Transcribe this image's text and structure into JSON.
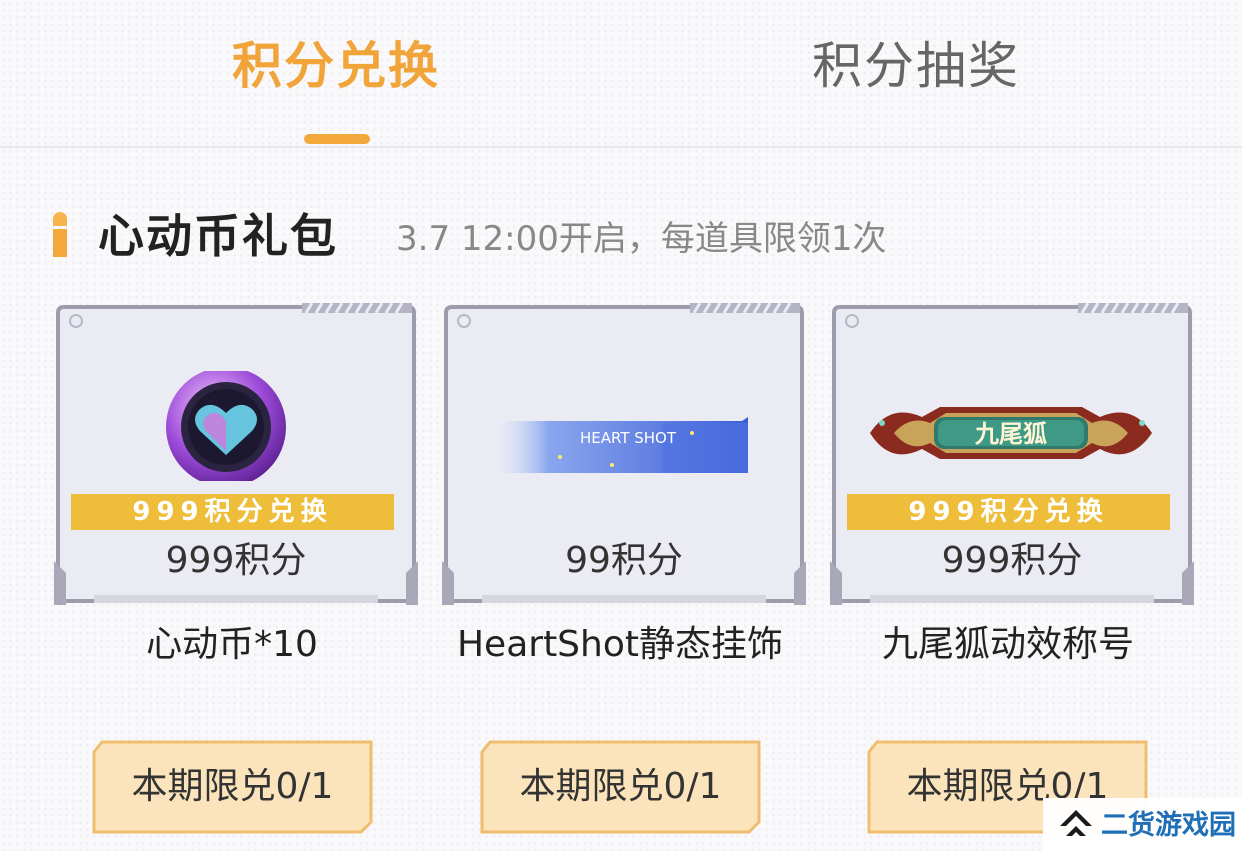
{
  "tabs": {
    "exchange": "积分兑换",
    "lottery": "积分抽奖"
  },
  "section": {
    "title": "心动币礼包",
    "subtitle": "3.7 12:00开启，每道具限领1次"
  },
  "items": [
    {
      "badge": "999积分兑换",
      "points": "999积分",
      "name": "心动币*10",
      "limit": "本期限兑0/1",
      "icon": "heart-coin-icon"
    },
    {
      "badge": "",
      "points": "99积分",
      "name": "HeartShot静态挂饰",
      "limit": "本期限兑0/1",
      "icon": "heartshot-banner-icon",
      "banner_text": "HEART SHOT"
    },
    {
      "badge": "999积分兑换",
      "points": "999积分",
      "name": "九尾狐动效称号",
      "limit": "本期限兑0/1",
      "icon": "nine-tail-fox-title-icon",
      "banner_text": "九尾狐"
    }
  ],
  "watermark": {
    "text": "二货游戏园",
    "icon": "watermark-logo-icon"
  },
  "colors": {
    "accent": "#f3a83c",
    "badge": "#eebd3a",
    "button_fill": "#fbe4bb",
    "button_border": "#f0bd6f"
  }
}
